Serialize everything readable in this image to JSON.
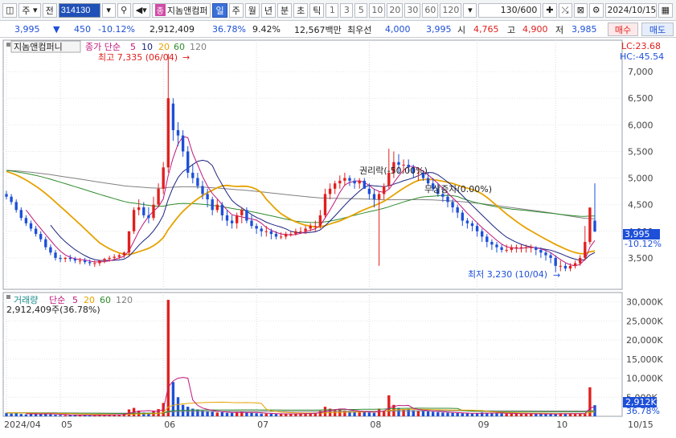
{
  "toolbar": {
    "market": "주",
    "prefix": "전",
    "code": "314130",
    "stock_badge": "종",
    "stock_name": "지놈앤컴퍼",
    "period_tabs": [
      "일",
      "주",
      "월",
      "년",
      "분",
      "초",
      "틱"
    ],
    "active_period": "일",
    "intervals": [
      "1",
      "3",
      "5",
      "10",
      "20",
      "30",
      "60",
      "120"
    ],
    "count": "130/600",
    "date": "2024/10/15"
  },
  "quote": {
    "price": "3,995",
    "change": "450",
    "change_pct": "-10.12%",
    "volume": "2,912,409",
    "volume_ratio": "36.78%",
    "turnover": "9.42%",
    "amount": "12,567백만",
    "priority_label": "최우선",
    "bid": "4,000",
    "ask": "3,995",
    "open_label": "시",
    "open": "4,765",
    "high_label": "고",
    "high": "4,900",
    "low_label": "저",
    "low": "3,985",
    "buy_label": "매수",
    "sell_label": "매도"
  },
  "price_panel": {
    "tab_label": "지놈앤컴퍼니",
    "legend_main": "종가 단순",
    "ma_periods": [
      "5",
      "10",
      "20",
      "60",
      "120"
    ],
    "high_note": "최고 7,335 (06/04)",
    "low_note": "최저 3,230 (10/04)",
    "rights_note": "권리락(-50.00%)",
    "free_note": "무상증자(0.00%)",
    "lc": "LC:23.68",
    "hc": "HC:-45.54",
    "yticks": [
      "7,000",
      "6,500",
      "6,000",
      "5,500",
      "5,000",
      "4,500",
      "4,000",
      "3,500"
    ],
    "current_price": "3,995",
    "current_pct": "-10.12%"
  },
  "volume_panel": {
    "legend_main": "거래량",
    "legend_ma": "단순",
    "ma_periods": [
      "5",
      "20",
      "60",
      "120"
    ],
    "value_note": "2,912,409주(36.78%)",
    "yticks": [
      "30,000K",
      "25,000K",
      "20,000K",
      "15,000K",
      "10,000K",
      "5,000K"
    ],
    "current_vol": "2,912K",
    "current_pct": "36.78%"
  },
  "xaxis": {
    "labels": [
      "2024/04",
      "05",
      "06",
      "07",
      "08",
      "09",
      "10",
      "10/15"
    ]
  },
  "colors": {
    "up": "#e0201e",
    "down": "#1d4fd8",
    "ma5": "#c0177c",
    "ma10": "#1a237e",
    "ma20": "#e6a200",
    "ma60": "#2e8b2e",
    "ma120": "#808080"
  },
  "chart_data": {
    "type": "candlestick",
    "dates": [
      "04/15",
      "04/16",
      "04/17",
      "04/18",
      "04/19",
      "04/22",
      "04/23",
      "04/24",
      "04/25",
      "04/26",
      "04/29",
      "04/30",
      "05/02",
      "05/03",
      "05/07",
      "05/08",
      "05/09",
      "05/10",
      "05/13",
      "05/14",
      "05/16",
      "05/17",
      "05/20",
      "05/21",
      "05/22",
      "05/23",
      "05/24",
      "05/27",
      "05/28",
      "05/29",
      "05/30",
      "05/31",
      "06/03",
      "06/04",
      "06/05",
      "06/07",
      "06/10",
      "06/11",
      "06/12",
      "06/13",
      "06/14",
      "06/17",
      "06/18",
      "06/19",
      "06/20",
      "06/21",
      "06/24",
      "06/25",
      "06/26",
      "06/27",
      "06/28",
      "07/01",
      "07/02",
      "07/03",
      "07/04",
      "07/05",
      "07/08",
      "07/09",
      "07/10",
      "07/11",
      "07/12",
      "07/15",
      "07/16",
      "07/17",
      "07/18",
      "07/19",
      "07/22",
      "07/23",
      "07/24",
      "07/25",
      "07/26",
      "07/29",
      "07/30",
      "07/31",
      "08/01",
      "08/02",
      "08/05",
      "08/06",
      "08/07",
      "08/08",
      "08/09",
      "08/12",
      "08/13",
      "08/14",
      "08/16",
      "08/19",
      "08/20",
      "08/21",
      "08/22",
      "08/23",
      "08/26",
      "08/27",
      "08/28",
      "08/29",
      "08/30",
      "09/02",
      "09/03",
      "09/04",
      "09/05",
      "09/06",
      "09/09",
      "09/10",
      "09/11",
      "09/12",
      "09/13",
      "09/19",
      "09/20",
      "09/23",
      "09/24",
      "09/25",
      "09/26",
      "09/27",
      "09/30",
      "10/02",
      "10/04",
      "10/07",
      "10/08",
      "10/10",
      "10/11",
      "10/14",
      "10/15"
    ],
    "open": [
      4700,
      4650,
      4550,
      4400,
      4250,
      4150,
      4050,
      3950,
      3850,
      3700,
      3600,
      3500,
      3480,
      3500,
      3480,
      3450,
      3450,
      3420,
      3400,
      3400,
      3450,
      3480,
      3500,
      3520,
      3550,
      3600,
      4000,
      4400,
      4450,
      4300,
      4250,
      4500,
      4800,
      5200,
      6400,
      5900,
      5800,
      5500,
      5100,
      5000,
      4850,
      4700,
      4600,
      4400,
      4500,
      4300,
      4200,
      4150,
      4300,
      4400,
      4200,
      4100,
      4050,
      4000,
      4000,
      3950,
      3900,
      3900,
      3950,
      3950,
      4000,
      4000,
      4050,
      4100,
      4100,
      4300,
      4700,
      4800,
      4900,
      4950,
      5000,
      4950,
      4900,
      4950,
      4800,
      4700,
      4600,
      4700,
      4850,
      5100,
      5300,
      5250,
      5250,
      5200,
      5100,
      5100,
      5000,
      4900,
      4800,
      4700,
      4650,
      4550,
      4450,
      4350,
      4200,
      4150,
      4100,
      4000,
      3900,
      3800,
      3750,
      3700,
      3650,
      3650,
      3700,
      3700,
      3700,
      3700,
      3700,
      3650,
      3600,
      3550,
      3500,
      3350,
      3350,
      3300,
      3350,
      3400,
      3500,
      3800,
      4200
    ],
    "high": [
      4760,
      4700,
      4600,
      4450,
      4300,
      4200,
      4100,
      4000,
      3900,
      3750,
      3650,
      3560,
      3520,
      3560,
      3520,
      3500,
      3500,
      3470,
      3450,
      3450,
      3500,
      3540,
      3570,
      3580,
      3620,
      4000,
      4450,
      4600,
      4550,
      4450,
      4650,
      4900,
      5300,
      7335,
      6500,
      6050,
      5900,
      5600,
      5250,
      5100,
      4950,
      4800,
      4650,
      4600,
      4550,
      4400,
      4300,
      4350,
      4450,
      4450,
      4300,
      4150,
      4100,
      4100,
      4050,
      4000,
      3980,
      3990,
      4000,
      4050,
      4080,
      4100,
      4150,
      4200,
      4400,
      4800,
      4900,
      4950,
      5050,
      5100,
      5050,
      5000,
      5000,
      5000,
      4900,
      4800,
      4750,
      4900,
      5550,
      5500,
      5450,
      5350,
      5350,
      5250,
      5200,
      5150,
      5100,
      5000,
      4900,
      4800,
      4700,
      4600,
      4500,
      4400,
      4250,
      4200,
      4150,
      4050,
      3950,
      3850,
      3800,
      3750,
      3750,
      3750,
      3750,
      3750,
      3750,
      3750,
      3720,
      3700,
      3650,
      3600,
      3550,
      3450,
      3400,
      3400,
      3450,
      3550,
      4100,
      4450,
      4900
    ],
    "low": [
      4600,
      4500,
      4350,
      4200,
      4100,
      4000,
      3900,
      3800,
      3650,
      3550,
      3450,
      3420,
      3420,
      3430,
      3400,
      3380,
      3380,
      3350,
      3330,
      3350,
      3400,
      3430,
      3460,
      3480,
      3500,
      3550,
      3950,
      4300,
      4250,
      4150,
      4200,
      4450,
      4700,
      5100,
      5700,
      5600,
      5400,
      5000,
      4900,
      4800,
      4600,
      4450,
      4300,
      4350,
      4200,
      4100,
      4050,
      4050,
      4150,
      4150,
      4050,
      3950,
      3900,
      3900,
      3850,
      3850,
      3850,
      3850,
      3900,
      3920,
      3950,
      3950,
      4000,
      4000,
      4050,
      4250,
      4600,
      4700,
      4800,
      4850,
      4850,
      4800,
      4800,
      4800,
      4600,
      4450,
      3350,
      4600,
      4800,
      5000,
      5100,
      5100,
      5100,
      5000,
      4950,
      4950,
      4850,
      4750,
      4650,
      4550,
      4450,
      4350,
      4250,
      4100,
      4050,
      4000,
      3900,
      3800,
      3700,
      3650,
      3600,
      3600,
      3600,
      3600,
      3600,
      3600,
      3600,
      3600,
      3550,
      3500,
      3450,
      3400,
      3230,
      3250,
      3250,
      3250,
      3300,
      3350,
      3450,
      3750,
      3985
    ],
    "close": [
      4650,
      4550,
      4400,
      4250,
      4150,
      4050,
      3950,
      3850,
      3700,
      3600,
      3500,
      3480,
      3500,
      3480,
      3450,
      3450,
      3420,
      3400,
      3400,
      3450,
      3480,
      3500,
      3520,
      3550,
      3600,
      4000,
      4400,
      4450,
      4300,
      4250,
      4500,
      4800,
      5200,
      6500,
      5900,
      5800,
      5500,
      5100,
      5000,
      4850,
      4700,
      4600,
      4400,
      4500,
      4300,
      4200,
      4150,
      4300,
      4400,
      4200,
      4100,
      4050,
      4000,
      4000,
      3950,
      3900,
      3900,
      3950,
      3950,
      4000,
      4000,
      4050,
      4100,
      4100,
      4300,
      4700,
      4800,
      4900,
      4950,
      5000,
      4950,
      4900,
      4950,
      4800,
      4700,
      4600,
      4700,
      4850,
      5100,
      5300,
      5250,
      5250,
      5200,
      5100,
      5100,
      5000,
      4900,
      4800,
      4700,
      4650,
      4550,
      4450,
      4350,
      4200,
      4150,
      4100,
      4000,
      3900,
      3800,
      3750,
      3700,
      3650,
      3650,
      3700,
      3700,
      3700,
      3700,
      3700,
      3650,
      3600,
      3550,
      3500,
      3350,
      3350,
      3300,
      3350,
      3400,
      3500,
      3800,
      4445,
      3995
    ],
    "volume_k": [
      900,
      700,
      800,
      600,
      500,
      600,
      700,
      600,
      800,
      500,
      400,
      350,
      300,
      350,
      300,
      280,
      300,
      250,
      300,
      400,
      350,
      400,
      450,
      500,
      700,
      1800,
      2200,
      1500,
      1000,
      900,
      1400,
      1900,
      3500,
      30500,
      9000,
      5000,
      3000,
      2500,
      2000,
      1800,
      1500,
      1300,
      1200,
      1000,
      1100,
      900,
      900,
      1100,
      1200,
      1000,
      900,
      800,
      700,
      700,
      650,
      600,
      600,
      650,
      650,
      700,
      700,
      750,
      800,
      900,
      1500,
      2500,
      2000,
      1800,
      1800,
      1500,
      1300,
      1200,
      1200,
      1100,
      1000,
      900,
      2000,
      1500,
      5500,
      3000,
      2200,
      1800,
      1800,
      1600,
      1500,
      1400,
      1300,
      1200,
      1100,
      1000,
      950,
      900,
      850,
      800,
      750,
      700,
      800,
      1000,
      900,
      850,
      800,
      750,
      700,
      700,
      700,
      650,
      650,
      650,
      650,
      650,
      600,
      600,
      600,
      800,
      700,
      650,
      700,
      700,
      800,
      7600,
      2912
    ],
    "ylim": [
      3000,
      7500
    ],
    "volume_ylim": [
      0,
      32000
    ]
  }
}
